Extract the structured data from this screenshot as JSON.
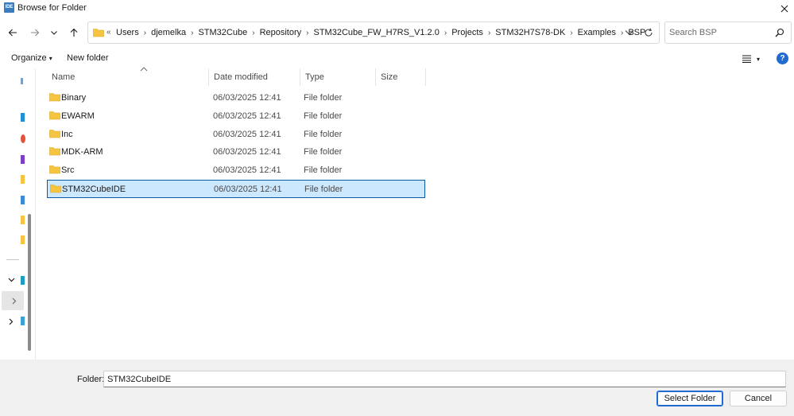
{
  "window": {
    "app_icon_text": "IDE",
    "title": "Browse for Folder"
  },
  "address": {
    "lead": "«",
    "crumbs": [
      "Users",
      "djemelka",
      "STM32Cube",
      "Repository",
      "STM32Cube_FW_H7RS_V1.2.0",
      "Projects",
      "STM32H7S78-DK",
      "Examples",
      "BSP"
    ]
  },
  "search": {
    "placeholder": "Search BSP"
  },
  "toolbar": {
    "organize_label": "Organize",
    "new_folder_label": "New folder",
    "help_label": "?"
  },
  "columns": {
    "name": "Name",
    "date": "Date modified",
    "type": "Type",
    "size": "Size"
  },
  "files": [
    {
      "name": "Binary",
      "date": "06/03/2025 12:41",
      "type": "File folder"
    },
    {
      "name": "EWARM",
      "date": "06/03/2025 12:41",
      "type": "File folder"
    },
    {
      "name": "Inc",
      "date": "06/03/2025 12:41",
      "type": "File folder"
    },
    {
      "name": "MDK-ARM",
      "date": "06/03/2025 12:41",
      "type": "File folder"
    },
    {
      "name": "Src",
      "date": "06/03/2025 12:41",
      "type": "File folder"
    },
    {
      "name": "STM32CubeIDE",
      "date": "06/03/2025 12:41",
      "type": "File folder"
    }
  ],
  "selected_index": 5,
  "footer": {
    "folder_label": "Folder:",
    "folder_value": "STM32CubeIDE",
    "select_label": "Select Folder",
    "cancel_label": "Cancel"
  },
  "colors": {
    "accent": "#1f6bd1",
    "selection_bg": "#cce8ff",
    "folder_yellow": "#f5c542"
  }
}
